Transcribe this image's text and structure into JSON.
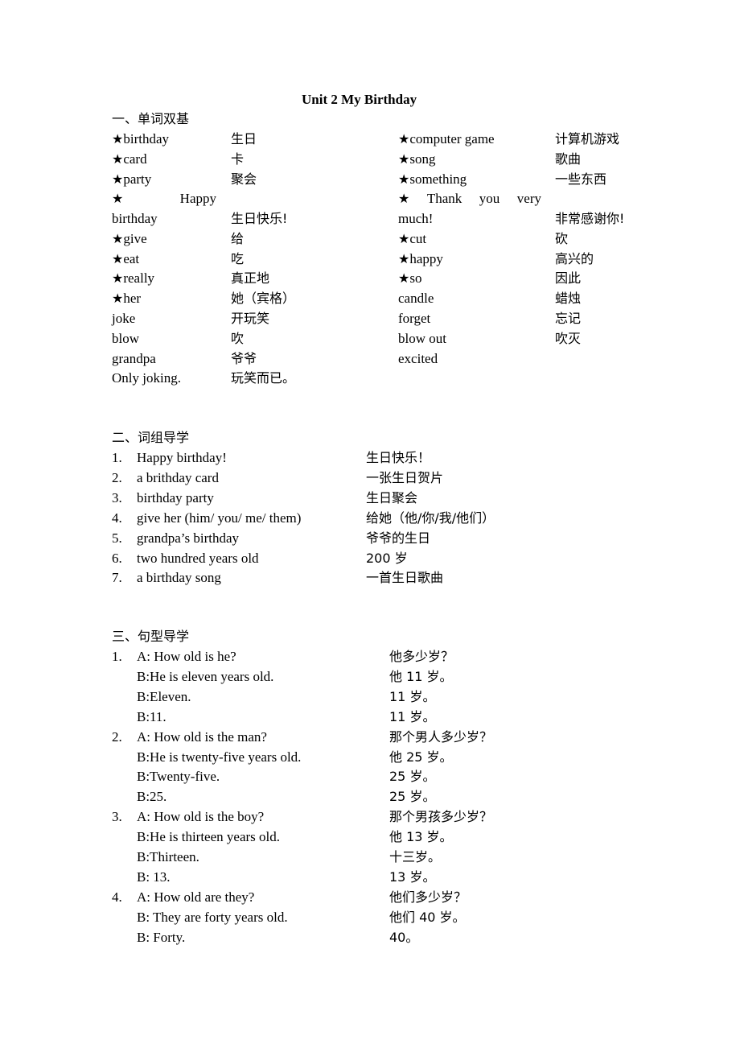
{
  "title": "Unit 2    My Birthday",
  "section1": {
    "heading": "一、单词双基",
    "left": [
      {
        "star": true,
        "en": "birthday",
        "cn": "生日"
      },
      {
        "star": true,
        "en": "card",
        "cn": "卡"
      },
      {
        "star": true,
        "en": "party",
        "cn": "聚会"
      },
      {
        "star": true,
        "en_line1": "Happy",
        "en": "birthday",
        "cn": "生日快乐!"
      },
      {
        "star": true,
        "en": "give",
        "cn": "给"
      },
      {
        "star": true,
        "en": "eat",
        "cn": "吃"
      },
      {
        "star": true,
        "en": "really",
        "cn": "真正地"
      },
      {
        "star": true,
        "en": "her",
        "cn": "她（宾格）"
      },
      {
        "star": false,
        "en": "joke",
        "cn": "开玩笑"
      },
      {
        "star": false,
        "en": "blow",
        "cn": "吹"
      },
      {
        "star": false,
        "en": "grandpa",
        "cn": "爷爷"
      },
      {
        "star": false,
        "en": "Only joking.",
        "cn": "玩笑而已。"
      }
    ],
    "right": [
      {
        "star": true,
        "en": "computer game",
        "cn": "计算机游戏"
      },
      {
        "star": true,
        "en": "song",
        "cn": "歌曲"
      },
      {
        "star": true,
        "en": "something",
        "cn": "一些东西"
      },
      {
        "star": true,
        "en_line1": [
          "Thank",
          "you",
          "very"
        ],
        "en": "much!",
        "cn": "非常感谢你!"
      },
      {
        "star": true,
        "en": "cut",
        "cn": "砍"
      },
      {
        "star": true,
        "en": "happy",
        "cn": "高兴的"
      },
      {
        "star": true,
        "en": "so",
        "cn": "因此"
      },
      {
        "star": false,
        "en": "candle",
        "cn": "蜡烛"
      },
      {
        "star": false,
        "en": "forget",
        "cn": "忘记"
      },
      {
        "star": false,
        "en": "blow out",
        "cn": "吹灭"
      },
      {
        "star": false,
        "en": "excited",
        "cn": ""
      }
    ]
  },
  "section2": {
    "heading": "二、词组导学",
    "items": [
      {
        "num": "1.",
        "en": "Happy birthday!",
        "cn": "生日快乐！"
      },
      {
        "num": "2.",
        "en": "a brithday card",
        "cn": "一张生日贺片"
      },
      {
        "num": "3.",
        "en": "birthday party",
        "cn": "生日聚会"
      },
      {
        "num": "4.",
        "en": "give her (him/ you/ me/ them)",
        "cn": "给她（他/你/我/他们）"
      },
      {
        "num": "5.",
        "en": "grandpa’s birthday",
        "cn": "爷爷的生日"
      },
      {
        "num": "6.",
        "en": "two hundred years old",
        "cn": "200 岁"
      },
      {
        "num": "7.",
        "en": "a birthday song",
        "cn": "一首生日歌曲"
      }
    ]
  },
  "section3": {
    "heading": "三、句型导学",
    "lines": [
      {
        "num": "1.",
        "en": "A: How old is he?",
        "cn": "他多少岁？"
      },
      {
        "num": "",
        "en": "B:He is eleven years old.",
        "cn": "他 11 岁。"
      },
      {
        "num": "",
        "en": "B:Eleven.",
        "cn": "11 岁。"
      },
      {
        "num": "",
        "en": "B:11.",
        "cn": "11 岁。"
      },
      {
        "num": "2.",
        "en": "A: How old is the man?",
        "cn": "那个男人多少岁？"
      },
      {
        "num": "",
        "en": "B:He is twenty-five years old.",
        "cn": "他 25 岁。"
      },
      {
        "num": "",
        "en": "B:Twenty-five.",
        "cn": "25 岁。"
      },
      {
        "num": "",
        "en": "B:25.",
        "cn": "25 岁。"
      },
      {
        "num": "3.",
        "en": "A: How old is the boy?",
        "cn": "那个男孩多少岁？"
      },
      {
        "num": "",
        "en": "B:He is thirteen years old.",
        "cn": "他 13 岁。"
      },
      {
        "num": "",
        "en": "B:Thirteen.",
        "cn": "十三岁。"
      },
      {
        "num": "",
        "en": "B: 13.",
        "cn": "13 岁。"
      },
      {
        "num": "4.",
        "en": "A: How old are they?",
        "cn": "他们多少岁？"
      },
      {
        "num": "",
        "en": "B: They are forty years old.",
        "cn": "他们 40 岁。"
      },
      {
        "num": "",
        "en": "B: Forty.",
        "cn": "40。"
      }
    ]
  }
}
